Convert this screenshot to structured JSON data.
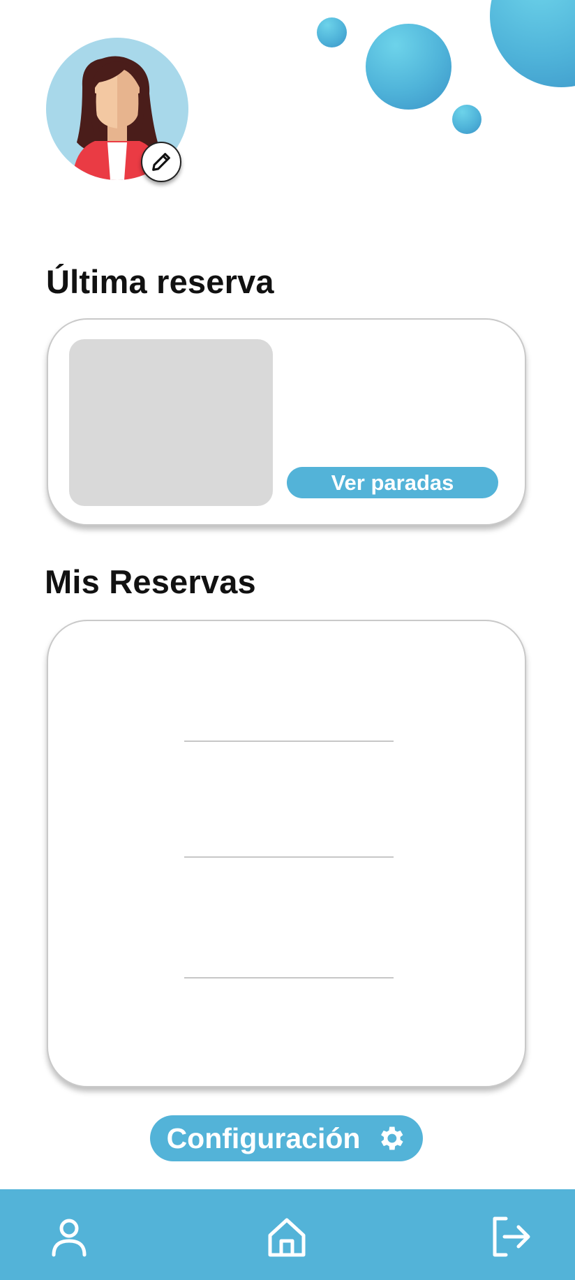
{
  "last_booking": {
    "title": "Última reserva",
    "button_label": "Ver paradas"
  },
  "my_bookings": {
    "title": "Mis Reservas"
  },
  "settings": {
    "label": "Configuración"
  },
  "icons": {
    "avatar": "user-avatar",
    "edit": "pencil-icon",
    "settings": "gear-icon",
    "nav_profile": "user-icon",
    "nav_home": "home-icon",
    "nav_logout": "logout-icon"
  },
  "colors": {
    "accent": "#53b3d8",
    "avatar_bg": "#a8d8ea",
    "placeholder": "#d9d9d9"
  }
}
